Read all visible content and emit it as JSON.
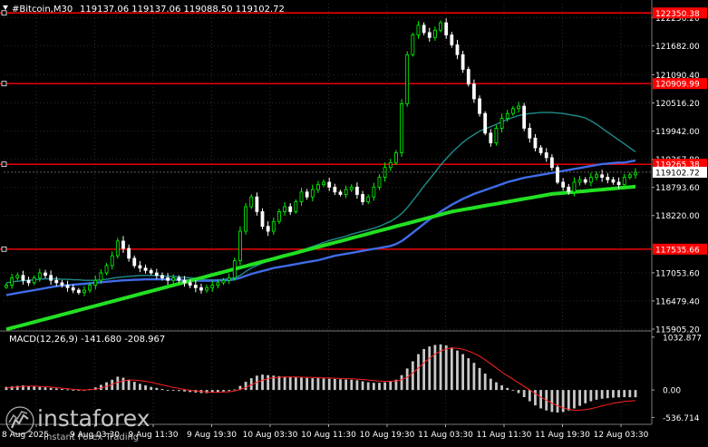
{
  "header": {
    "symbol": "#Bitcoin,M30",
    "ohlc": "119137.06 119137.06 119088.50 119102.72"
  },
  "colors": {
    "background": "#000000",
    "grid": "#2b2b2b",
    "bull": "#00ff00",
    "bear": "#ffffff",
    "ma_blue": "#3f6ce8",
    "ma_teal": "#1f8c8c",
    "ma_green": "#22e022",
    "level_line": "#ff0000",
    "macd_hist": "#c8c8c8",
    "macd_signal": "#ff2020",
    "axis_text": "#ffffff",
    "price_label_bg": "#ff0000"
  },
  "chart_data": {
    "type": "candlestick",
    "price_axis": {
      "ylim": [
        115905.0,
        122540.0
      ],
      "ticks": [
        "122256.20",
        "121682.00",
        "121090.40",
        "120516.20",
        "119942.00",
        "119367.80",
        "118793.60",
        "118220.00",
        "117053.60",
        "116479.40",
        "115905.20"
      ]
    },
    "time_axis": {
      "labels": [
        "8 Aug 2025",
        "9 Aug 03:30",
        "9 Aug 11:30",
        "9 Aug 19:30",
        "10 Aug 03:30",
        "10 Aug 11:30",
        "10 Aug 19:30",
        "11 Aug 03:30",
        "11 Aug 11:30",
        "11 Aug 19:30",
        "12 Aug 03:30"
      ]
    },
    "levels": [
      {
        "value": 122350.38,
        "label": "122350.38"
      },
      {
        "value": 120909.99,
        "label": "120909.99"
      },
      {
        "value": 119265.38,
        "label": "119265.38"
      },
      {
        "value": 117535.66,
        "label": "117535.66"
      }
    ],
    "current_price": {
      "value": 119102.72,
      "label": "119102.72"
    },
    "close_series": [
      116800,
      116950,
      117000,
      116900,
      116850,
      116950,
      117050,
      117000,
      116900,
      116850,
      116800,
      116750,
      116700,
      116650,
      116700,
      116800,
      116900,
      117050,
      117200,
      117400,
      117700,
      117550,
      117350,
      117200,
      117150,
      117100,
      117050,
      117000,
      116950,
      116900,
      116950,
      116900,
      116850,
      116800,
      116750,
      116700,
      116750,
      116800,
      116850,
      116900,
      116950,
      117300,
      117900,
      118400,
      118600,
      118300,
      118000,
      117900,
      118100,
      118300,
      118400,
      118300,
      118500,
      118700,
      118600,
      118750,
      118850,
      118900,
      118800,
      118700,
      118650,
      118750,
      118800,
      118650,
      118500,
      118600,
      118800,
      119000,
      119200,
      119300,
      119500,
      120500,
      121500,
      121900,
      122100,
      121950,
      121850,
      122000,
      122150,
      121900,
      121700,
      121500,
      121200,
      120900,
      120600,
      120300,
      119900,
      119700,
      120000,
      120200,
      120300,
      120400,
      120450,
      120000,
      119800,
      119600,
      119500,
      119400,
      119200,
      118900,
      118800,
      118700,
      118900,
      118950,
      118900,
      119000,
      119050,
      119000,
      118950,
      118900,
      118850,
      119000,
      119050,
      119100
    ],
    "ma_teal": [
      116850,
      116870,
      116880,
      116890,
      116900,
      116910,
      116920,
      116930,
      116930,
      116930,
      116920,
      116920,
      116910,
      116910,
      116900,
      116900,
      116900,
      116910,
      116920,
      116940,
      116960,
      116970,
      116980,
      116990,
      117000,
      117000,
      117000,
      117000,
      116990,
      116980,
      116980,
      116970,
      116960,
      116950,
      116940,
      116920,
      116910,
      116910,
      116910,
      116920,
      116930,
      116950,
      117000,
      117080,
      117150,
      117200,
      117250,
      117290,
      117330,
      117370,
      117410,
      117440,
      117470,
      117510,
      117550,
      117590,
      117630,
      117670,
      117710,
      117740,
      117770,
      117800,
      117840,
      117870,
      117900,
      117930,
      117960,
      118000,
      118050,
      118100,
      118170,
      118260,
      118380,
      118520,
      118670,
      118820,
      118960,
      119100,
      119250,
      119380,
      119500,
      119610,
      119710,
      119800,
      119870,
      119940,
      119990,
      120030,
      120080,
      120130,
      120180,
      120220,
      120260,
      120280,
      120300,
      120310,
      120320,
      120320,
      120320,
      120310,
      120300,
      120280,
      120260,
      120240,
      120210,
      120150,
      120080,
      120000,
      119920,
      119840,
      119760,
      119680,
      119600,
      119520
    ],
    "ma_blue": [
      116600,
      116620,
      116640,
      116660,
      116680,
      116700,
      116720,
      116740,
      116760,
      116780,
      116790,
      116800,
      116810,
      116820,
      116830,
      116840,
      116850,
      116860,
      116870,
      116880,
      116890,
      116900,
      116905,
      116910,
      116915,
      116920,
      116920,
      116920,
      116920,
      116920,
      116915,
      116910,
      116905,
      116900,
      116895,
      116890,
      116890,
      116890,
      116895,
      116900,
      116905,
      116920,
      116950,
      116990,
      117030,
      117060,
      117090,
      117120,
      117150,
      117170,
      117190,
      117210,
      117230,
      117250,
      117270,
      117290,
      117310,
      117340,
      117370,
      117400,
      117420,
      117440,
      117460,
      117480,
      117500,
      117520,
      117540,
      117560,
      117580,
      117600,
      117640,
      117700,
      117780,
      117870,
      117960,
      118050,
      118140,
      118220,
      118300,
      118370,
      118440,
      118500,
      118560,
      118610,
      118660,
      118700,
      118740,
      118780,
      118820,
      118860,
      118900,
      118930,
      118960,
      118990,
      119010,
      119030,
      119050,
      119070,
      119090,
      119110,
      119130,
      119150,
      119170,
      119190,
      119210,
      119230,
      119250,
      119270,
      119280,
      119290,
      119300,
      119300,
      119320,
      119340
    ],
    "ma_green": [
      115900,
      115930,
      115960,
      115990,
      116020,
      116050,
      116080,
      116110,
      116140,
      116170,
      116200,
      116230,
      116260,
      116290,
      116320,
      116350,
      116380,
      116410,
      116440,
      116470,
      116500,
      116530,
      116560,
      116590,
      116620,
      116650,
      116680,
      116710,
      116740,
      116770,
      116800,
      116830,
      116860,
      116890,
      116920,
      116950,
      116980,
      117010,
      117040,
      117070,
      117100,
      117130,
      117160,
      117190,
      117220,
      117250,
      117280,
      117310,
      117340,
      117370,
      117400,
      117430,
      117460,
      117490,
      117520,
      117550,
      117580,
      117610,
      117640,
      117670,
      117700,
      117730,
      117760,
      117790,
      117820,
      117850,
      117880,
      117910,
      117940,
      117970,
      118000,
      118030,
      118060,
      118090,
      118120,
      118150,
      118180,
      118210,
      118240,
      118270,
      118300,
      118320,
      118340,
      118360,
      118380,
      118400,
      118420,
      118440,
      118460,
      118480,
      118500,
      118520,
      118540,
      118560,
      118580,
      118600,
      118620,
      118640,
      118660,
      118670,
      118680,
      118690,
      118700,
      118710,
      118720,
      118730,
      118740,
      118750,
      118760,
      118770,
      118780,
      118790,
      118800,
      118810
    ],
    "macd": {
      "label": "MACD(12,26,9) -141.680 -208.967",
      "ylim": [
        -600,
        1100
      ],
      "ticks": [
        "1032.877",
        "0.00",
        "-536.714"
      ],
      "histogram": [
        60,
        70,
        80,
        90,
        80,
        70,
        60,
        50,
        40,
        30,
        20,
        10,
        0,
        -10,
        0,
        20,
        50,
        100,
        150,
        200,
        260,
        240,
        200,
        160,
        120,
        90,
        60,
        40,
        20,
        0,
        -10,
        -20,
        -30,
        -40,
        -50,
        -60,
        -60,
        -50,
        -40,
        -30,
        -20,
        10,
        80,
        160,
        230,
        280,
        300,
        290,
        280,
        270,
        260,
        250,
        245,
        240,
        235,
        230,
        230,
        225,
        220,
        215,
        210,
        205,
        200,
        190,
        170,
        150,
        140,
        140,
        150,
        170,
        200,
        290,
        420,
        560,
        700,
        800,
        850,
        880,
        890,
        870,
        830,
        770,
        700,
        620,
        530,
        430,
        320,
        220,
        150,
        90,
        40,
        0,
        -60,
        -140,
        -220,
        -300,
        -360,
        -400,
        -430,
        -440,
        -430,
        -400,
        -360,
        -310,
        -260,
        -220,
        -190,
        -170,
        -160,
        -150,
        -145,
        -140,
        -141,
        -142
      ],
      "signal": [
        40,
        50,
        60,
        70,
        75,
        75,
        70,
        65,
        55,
        45,
        35,
        25,
        15,
        5,
        0,
        5,
        15,
        40,
        70,
        110,
        150,
        180,
        195,
        195,
        185,
        170,
        150,
        125,
        100,
        75,
        50,
        30,
        10,
        -5,
        -20,
        -30,
        -40,
        -45,
        -45,
        -40,
        -35,
        -20,
        10,
        50,
        100,
        150,
        190,
        220,
        240,
        250,
        255,
        255,
        255,
        250,
        248,
        245,
        242,
        238,
        234,
        230,
        226,
        222,
        218,
        212,
        205,
        195,
        185,
        175,
        170,
        170,
        175,
        200,
        250,
        330,
        430,
        530,
        620,
        700,
        760,
        800,
        820,
        815,
        795,
        760,
        715,
        660,
        590,
        510,
        430,
        350,
        280,
        210,
        140,
        70,
        0,
        -70,
        -140,
        -200,
        -260,
        -310,
        -350,
        -380,
        -395,
        -395,
        -385,
        -365,
        -340,
        -310,
        -285,
        -260,
        -240,
        -225,
        -215,
        -209
      ]
    }
  },
  "watermark": {
    "brand": "instaforex",
    "tagline": "Instant Forex Trading"
  }
}
